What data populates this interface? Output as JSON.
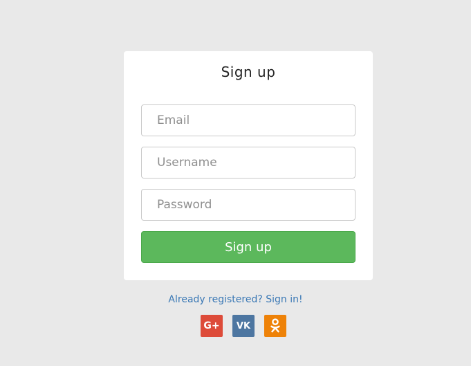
{
  "form": {
    "title": "Sign up",
    "email_placeholder": "Email",
    "username_placeholder": "Username",
    "password_placeholder": "Password",
    "submit_label": "Sign up"
  },
  "footer": {
    "signin_text": "Already registered? Sign in!"
  },
  "social": {
    "google_label": "G+",
    "vk_label": "VK",
    "colors": {
      "google": "#dd4b39",
      "vk": "#4d76a1",
      "ok": "#ee8208"
    }
  },
  "colors": {
    "background": "#e9e9e9",
    "card": "#ffffff",
    "button": "#5cb85c",
    "link": "#3a78b5"
  }
}
